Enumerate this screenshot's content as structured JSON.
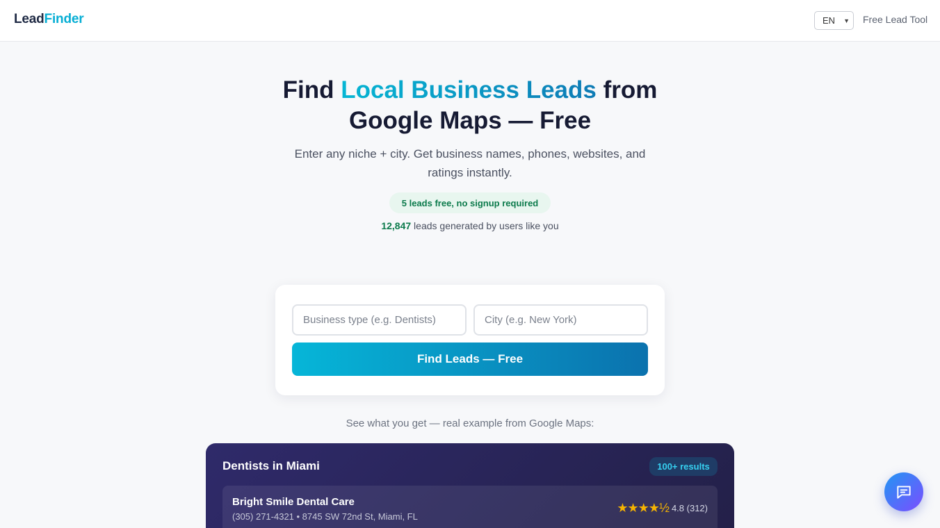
{
  "header": {
    "logo_part1": "Lead",
    "logo_part2": "Finder",
    "language": "EN",
    "free_tool_label": "Free Lead Tool"
  },
  "hero": {
    "title_start": "Find ",
    "title_highlight": "Local Business Leads",
    "title_end": " from Google Maps — Free",
    "subtitle": "Enter any niche + city. Get business names, phones, websites, and ratings instantly.",
    "free_pill": "5 leads free, no signup required",
    "counter_value": "12,847",
    "counter_text": " leads generated by users like you"
  },
  "search": {
    "business_placeholder": "Business type (e.g. Dentists)",
    "city_placeholder": "City (e.g. New York)",
    "business_value": "",
    "city_value": "",
    "submit_label": "Find Leads — Free"
  },
  "example": {
    "caption": "See what you get — real example from Google Maps:",
    "title": "Dentists in Miami",
    "results_badge": "100+ results",
    "rows": [
      {
        "name": "Bright Smile Dental Care",
        "meta": "(305) 271-4321 • 8745 SW 72nd St, Miami, FL",
        "stars": "★★★★½",
        "rating": "4.8 (312)"
      }
    ]
  },
  "colors": {
    "brand_cyan": "#06aed4",
    "brand_dark": "#1f2a44",
    "success_green": "#0b7a4b",
    "button_gradient_start": "#06b6d8",
    "button_gradient_end": "#0b72ae",
    "demo_bg": "#2f2a6a",
    "star_gold": "#f5b301"
  },
  "icons": {
    "chat": "chat-bubble-icon",
    "language_dropdown": "chevron-down-icon"
  }
}
